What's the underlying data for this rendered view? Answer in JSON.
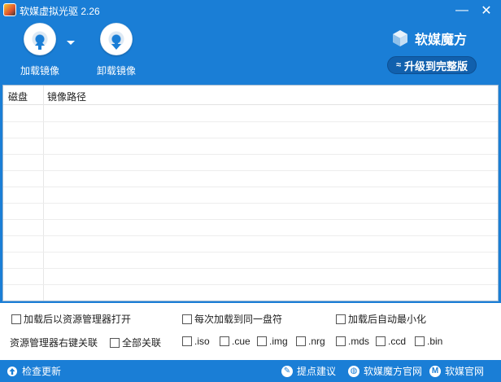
{
  "window": {
    "title": "软媒虚拟光驱 2.26",
    "minimize_glyph": "—",
    "close_glyph": "✕"
  },
  "toolbar": {
    "load_label": "加载镜像",
    "unload_label": "卸载镜像",
    "brand_name": "软媒魔方",
    "upgrade_label": "升级到完整版",
    "upgrade_icon_glyph": "≈"
  },
  "table": {
    "columns": [
      "磁盘",
      "镜像路径"
    ]
  },
  "options": {
    "open_explorer_after_load": "加载后以资源管理器打开",
    "same_drive_letter": "每次加载到同一盘符",
    "minimize_after_load": "加载后自动最小化",
    "explorer_context_assoc": "资源管理器右键关联",
    "associate_all": "全部关联",
    "extensions": [
      ".iso",
      ".cue",
      ".img",
      ".nrg",
      ".mds",
      ".ccd",
      ".bin"
    ]
  },
  "status": {
    "check_update": "检查更新",
    "feedback": "提点建议",
    "mofang_site": "软媒魔方官网",
    "ruanmei_site": "软媒官网",
    "feedback_icon": "feather-icon",
    "mofang_icon": "globe-icon",
    "ruanmei_icon": "m-logo-icon"
  },
  "colors": {
    "accent": "#1a7ed6",
    "upgrade_bg": "#1160ad"
  }
}
